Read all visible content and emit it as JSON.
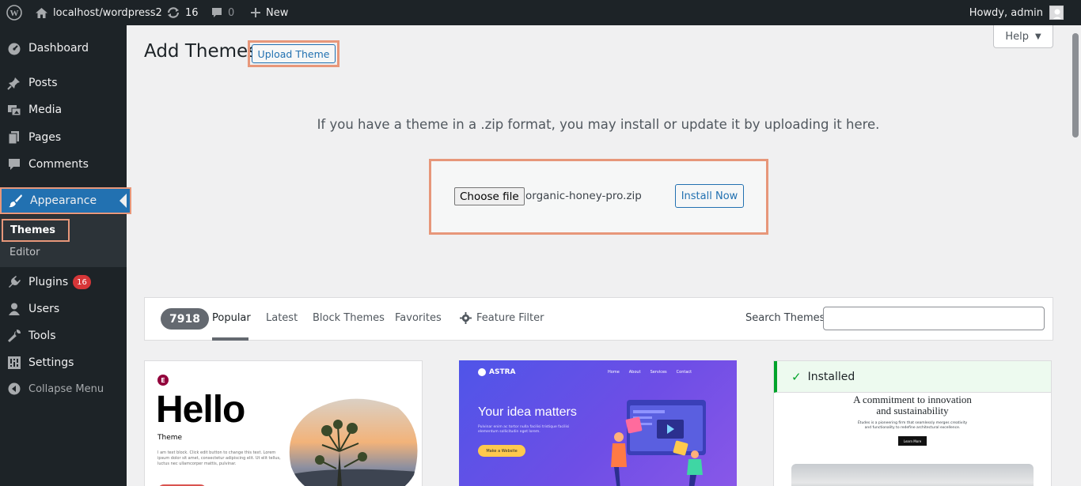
{
  "admin_bar": {
    "site": "localhost/wordpress2",
    "updates_count": "16",
    "comments_count": "0",
    "new_label": "New",
    "greeting": "Howdy, admin"
  },
  "sidebar": {
    "dashboard": "Dashboard",
    "posts": "Posts",
    "media": "Media",
    "pages": "Pages",
    "comments": "Comments",
    "appearance": "Appearance",
    "themes": "Themes",
    "editor": "Editor",
    "plugins": "Plugins",
    "plugins_badge": "16",
    "users": "Users",
    "tools": "Tools",
    "settings": "Settings",
    "collapse": "Collapse Menu"
  },
  "header": {
    "title": "Add Themes",
    "upload_button": "Upload Theme",
    "help_button": "Help"
  },
  "upload": {
    "description": "If you have a theme in a .zip format, you may install or update it by uploading it here.",
    "choose_file": "Choose file",
    "file_name": "organic-honey-pro.zip",
    "install_button": "Install Now"
  },
  "filter": {
    "count": "7918",
    "tabs": [
      "Popular",
      "Latest",
      "Block Themes",
      "Favorites"
    ],
    "feature_filter": "Feature Filter",
    "search_label": "Search Themes",
    "search_value": ""
  },
  "themes": {
    "hello": {
      "logo": "E",
      "title": "Hello",
      "subtitle": "Theme",
      "body": "I am text block. Click edit button to change this text. Lorem ipsum dolor sit amet, consectetur adipiscing elit. Ut elit tellus, luctus nec ullamcorper mattis, pulvinar."
    },
    "astra": {
      "brand": "ASTRA",
      "nav": [
        "Home",
        "About",
        "Services",
        "Contact"
      ],
      "headline": "Your idea matters",
      "body": "Pulvinar enim ac tortor nulla facilisi tristique facilisi elementum sollicitudin eget lorem.",
      "button": "Make a Website"
    },
    "third": {
      "installed_label": "Installed",
      "headline_1": "A commitment to innovation",
      "headline_2": "and sustainability",
      "body": "Études is a pioneering firm that seamlessly merges creativity and functionality to redefine architectural excellence.",
      "button": "Learn More"
    }
  },
  "colors": {
    "admin_dark": "#1d2327",
    "accent": "#2271b1",
    "highlight": "#e7977a",
    "badge": "#d63638",
    "installed_green": "#00a32a"
  }
}
